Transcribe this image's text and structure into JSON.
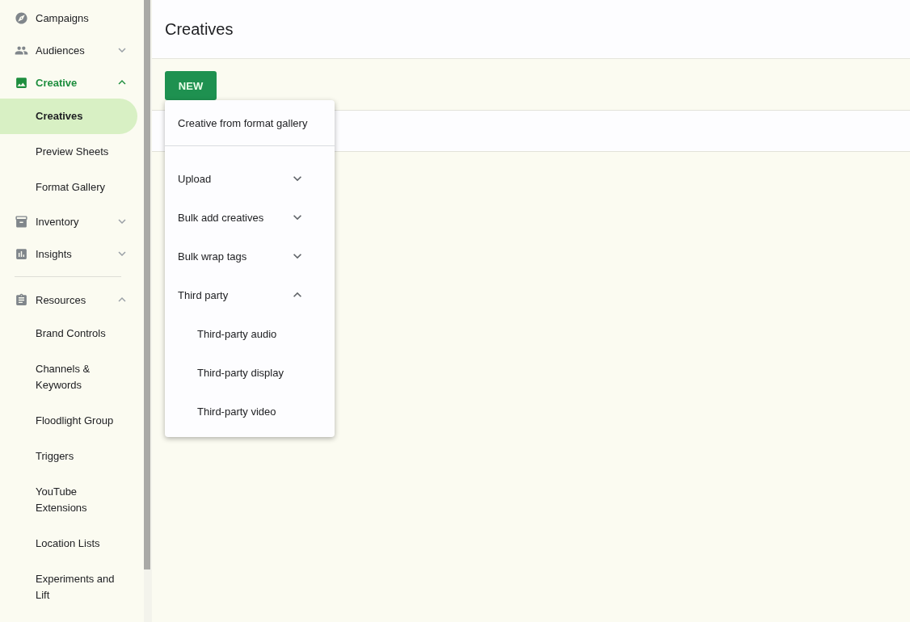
{
  "sidebar": {
    "sections": [
      {
        "items": [
          {
            "label": "Campaigns",
            "active": false
          },
          {
            "label": "Audiences",
            "active": false,
            "expanded": false
          },
          {
            "label": "Creative",
            "active": true,
            "expanded": true,
            "children": [
              {
                "label": "Creatives",
                "selected": true
              },
              {
                "label": "Preview Sheets",
                "selected": false
              },
              {
                "label": "Format Gallery",
                "selected": false
              }
            ]
          },
          {
            "label": "Inventory",
            "active": false,
            "expanded": false
          },
          {
            "label": "Insights",
            "active": false,
            "expanded": false
          }
        ]
      },
      {
        "items": [
          {
            "label": "Resources",
            "active": false,
            "expanded": true,
            "children": [
              {
                "label": "Brand Controls",
                "selected": false
              },
              {
                "label": "Channels & Keywords",
                "selected": false
              },
              {
                "label": "Floodlight Group",
                "selected": false
              },
              {
                "label": "Triggers",
                "selected": false
              },
              {
                "label": "YouTube Extensions",
                "selected": false
              },
              {
                "label": "Location Lists",
                "selected": false
              },
              {
                "label": "Experiments and Lift",
                "selected": false
              }
            ]
          }
        ]
      }
    ]
  },
  "page": {
    "title": "Creatives",
    "new_button": "NEW"
  },
  "new_menu": {
    "items": [
      {
        "kind": "link",
        "label": "Creative from format gallery"
      },
      {
        "kind": "expandable",
        "label": "Upload",
        "expanded": false
      },
      {
        "kind": "expandable",
        "label": "Bulk add creatives",
        "expanded": false
      },
      {
        "kind": "expandable",
        "label": "Bulk wrap tags",
        "expanded": false
      },
      {
        "kind": "expandable",
        "label": "Third party",
        "expanded": true,
        "children": [
          {
            "label": "Third-party audio"
          },
          {
            "label": "Third-party display"
          },
          {
            "label": "Third-party video"
          }
        ]
      }
    ]
  }
}
